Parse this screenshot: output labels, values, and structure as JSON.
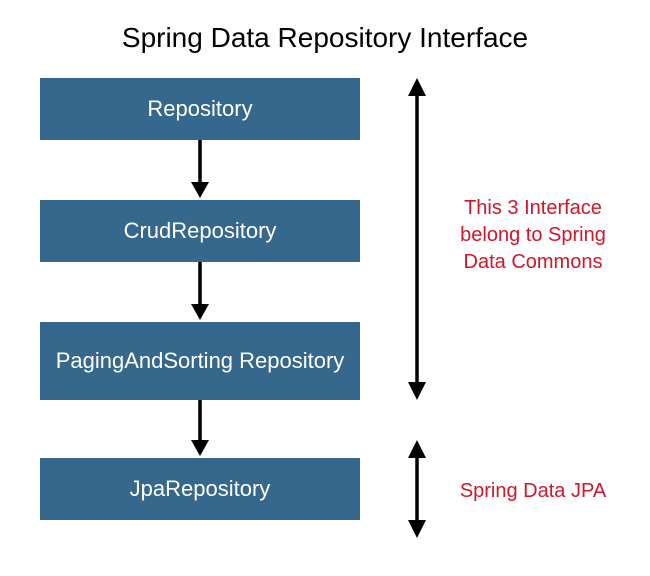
{
  "title": "Spring Data Repository Interface",
  "boxes": {
    "repository": "Repository",
    "crud": "CrudRepository",
    "paging": "PagingAndSorting Repository",
    "jpa": "JpaRepository"
  },
  "notes": {
    "commons_line1": "This 3 Interface",
    "commons_line2": "belong to Spring",
    "commons_line3": "Data Commons",
    "jpa": "Spring Data JPA"
  },
  "colors": {
    "box_bg": "#36688d",
    "note_color": "#d4152a"
  }
}
